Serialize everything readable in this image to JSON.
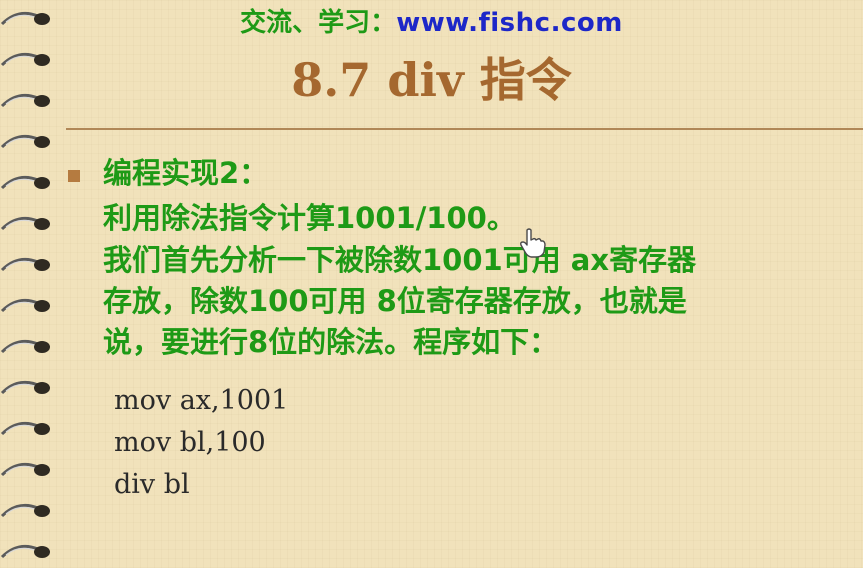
{
  "header": {
    "prefix": "交流、学习：",
    "url": "www.fishc.com"
  },
  "slide": {
    "title": "8.7 div 指令",
    "heading": "编程实现2：",
    "task": "利用除法指令计算1001/100。",
    "analysis_lines": [
      "我们首先分析一下被除数1001可用 ax寄存器",
      "存放，除数100可用 8位寄存器存放，也就是",
      "说，要进行8位的除法。程序如下："
    ],
    "code": [
      "mov ax,1001",
      "mov bl,100",
      "div bl"
    ]
  },
  "colors": {
    "background": "#f1e2bb",
    "text_green": "#1e9a16",
    "url_blue": "#1d27c8",
    "title_brown": "#a5682f"
  },
  "icons": {
    "cursor": "hand-cursor-icon",
    "binding": "spiral-binding"
  }
}
